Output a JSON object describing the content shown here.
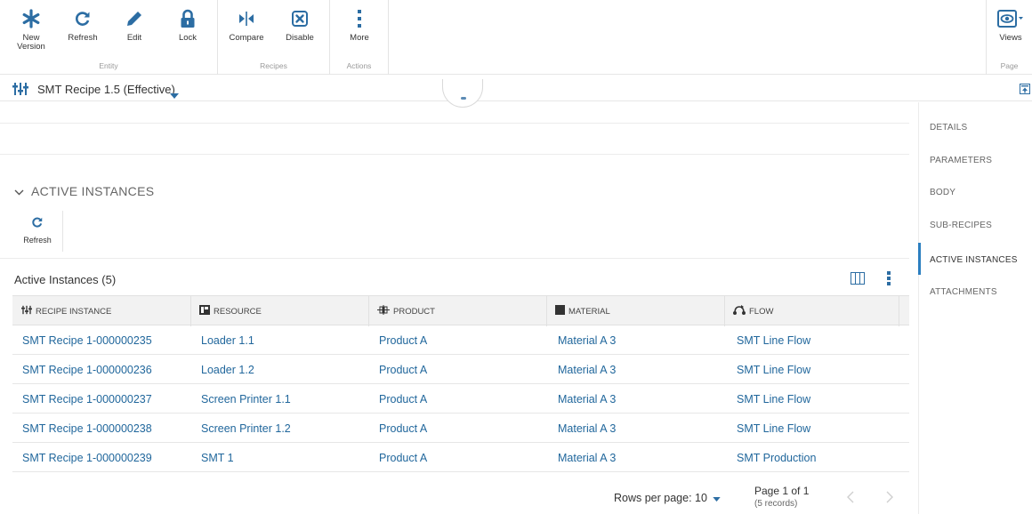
{
  "ribbon": {
    "groups": [
      {
        "caption": "Entity",
        "buttons": [
          {
            "label": "New Version",
            "icon": "asterisk-icon"
          },
          {
            "label": "Refresh",
            "icon": "refresh-icon"
          },
          {
            "label": "Edit",
            "icon": "pencil-icon"
          },
          {
            "label": "Lock",
            "icon": "lock-icon"
          }
        ]
      },
      {
        "caption": "Recipes",
        "buttons": [
          {
            "label": "Compare",
            "icon": "compare-icon"
          },
          {
            "label": "Disable",
            "icon": "disable-icon"
          }
        ]
      },
      {
        "caption": "Actions",
        "buttons": [
          {
            "label": "More",
            "icon": "more-vertical-icon"
          }
        ]
      },
      {
        "caption": "Page",
        "buttons": [
          {
            "label": "Views",
            "icon": "eye-icon"
          }
        ]
      }
    ]
  },
  "recipe_bar": {
    "title": "SMT Recipe 1.5 (Effective)"
  },
  "section": {
    "title": "ACTIVE INSTANCES",
    "refresh_label": "Refresh"
  },
  "grid": {
    "title": "Active Instances (5)",
    "columns": [
      {
        "label": "RECIPE INSTANCE",
        "icon": "recipe-icon"
      },
      {
        "label": "RESOURCE",
        "icon": "resource-icon"
      },
      {
        "label": "PRODUCT",
        "icon": "product-icon"
      },
      {
        "label": "MATERIAL",
        "icon": "material-icon"
      },
      {
        "label": "FLOW",
        "icon": "flow-icon"
      }
    ],
    "rows": [
      [
        "SMT Recipe 1-000000235",
        "Loader 1.1",
        "Product A",
        "Material A 3",
        "SMT Line Flow"
      ],
      [
        "SMT Recipe 1-000000236",
        "Loader 1.2",
        "Product A",
        "Material A 3",
        "SMT Line Flow"
      ],
      [
        "SMT Recipe 1-000000237",
        "Screen Printer 1.1",
        "Product A",
        "Material A 3",
        "SMT Line Flow"
      ],
      [
        "SMT Recipe 1-000000238",
        "Screen Printer 1.2",
        "Product A",
        "Material A 3",
        "SMT Line Flow"
      ],
      [
        "SMT Recipe 1-000000239",
        "SMT 1",
        "Product A",
        "Material A 3",
        "SMT Production"
      ]
    ]
  },
  "footer": {
    "rows_per_page_label": "Rows per page: 10",
    "page_label": "Page 1 of 1",
    "records_label": "(5 records)"
  },
  "right_nav": {
    "items": [
      "DETAILS",
      "PARAMETERS",
      "BODY",
      "SUB-RECIPES",
      "ACTIVE INSTANCES",
      "ATTACHMENTS"
    ],
    "active": "ACTIVE INSTANCES"
  },
  "colors": {
    "accent": "#21679c",
    "active_bar": "#2c7fc0"
  }
}
